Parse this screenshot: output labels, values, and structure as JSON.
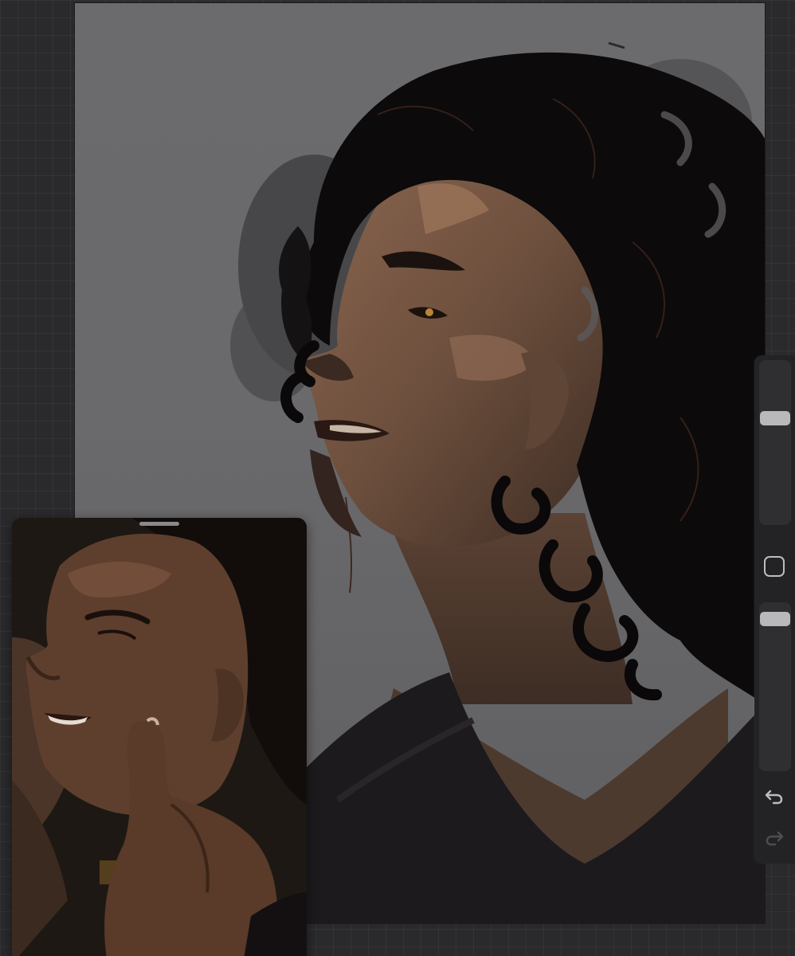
{
  "app": {
    "accent": "#b9b9bb"
  },
  "canvas": {
    "background_color": "#6a6a6c"
  },
  "reference_window": {
    "visible": true
  },
  "sidebar": {
    "brush_size_level": 0.33,
    "brush_opacity_level": 0.04,
    "modify_icon": "square-outline-icon",
    "undo_icon": "undo-arrow-icon",
    "redo_icon": "redo-arrow-icon",
    "redo_enabled": false
  }
}
